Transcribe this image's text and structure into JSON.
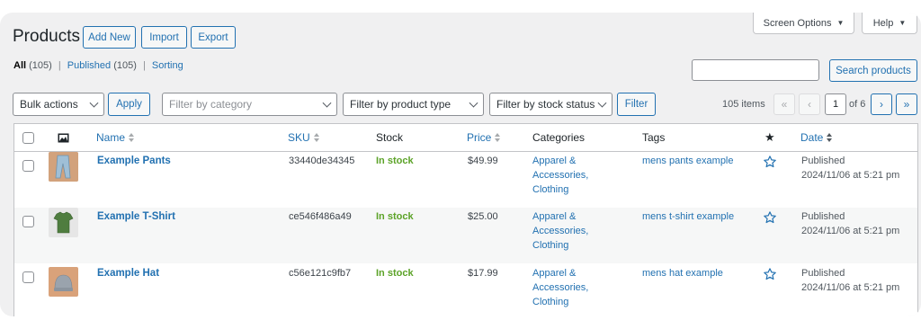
{
  "screen": {
    "options_label": "Screen Options",
    "help_label": "Help"
  },
  "header": {
    "title": "Products",
    "add_new": "Add New",
    "import": "Import",
    "export": "Export"
  },
  "subsubsub": {
    "all_label": "All",
    "all_count": "(105)",
    "published_label": "Published",
    "published_count": "(105)",
    "sorting_label": "Sorting",
    "sep": "|"
  },
  "search": {
    "value": "",
    "button": "Search products"
  },
  "filters": {
    "bulk_actions": "Bulk actions",
    "apply": "Apply",
    "category_placeholder": "Filter by category",
    "product_type": "Filter by product type",
    "stock_status": "Filter by stock status",
    "filter_button": "Filter"
  },
  "pagination": {
    "items": "105 items",
    "first": "«",
    "prev": "‹",
    "current": "1",
    "of": "of 6",
    "next": "›",
    "last": "»"
  },
  "columns": {
    "name": "Name",
    "sku": "SKU",
    "stock": "Stock",
    "price": "Price",
    "categories": "Categories",
    "tags": "Tags",
    "featured": "★",
    "date": "Date"
  },
  "products": [
    {
      "name": "Example Pants",
      "sku": "33440de34345",
      "stock": "In stock",
      "price": "$49.99",
      "categories": [
        "Apparel &",
        "Accessories,",
        "Clothing"
      ],
      "tags": "mens pants example",
      "date_status": "Published",
      "date": "2024/11/06 at 5:21 pm"
    },
    {
      "name": "Example T-Shirt",
      "sku": "ce546f486a49",
      "stock": "In stock",
      "price": "$25.00",
      "categories": [
        "Apparel &",
        "Accessories,",
        "Clothing"
      ],
      "tags": "mens t-shirt example",
      "date_status": "Published",
      "date": "2024/11/06 at 5:21 pm"
    },
    {
      "name": "Example Hat",
      "sku": "c56e121c9fb7",
      "stock": "In stock",
      "price": "$17.99",
      "categories": [
        "Apparel &",
        "Accessories,",
        "Clothing"
      ],
      "tags": "mens hat example",
      "date_status": "Published",
      "date": "2024/11/06 at 5:21 pm"
    }
  ],
  "colors": {
    "accent": "#2271b1",
    "in_stock": "#5ca328",
    "background": "#f0f0f1"
  }
}
